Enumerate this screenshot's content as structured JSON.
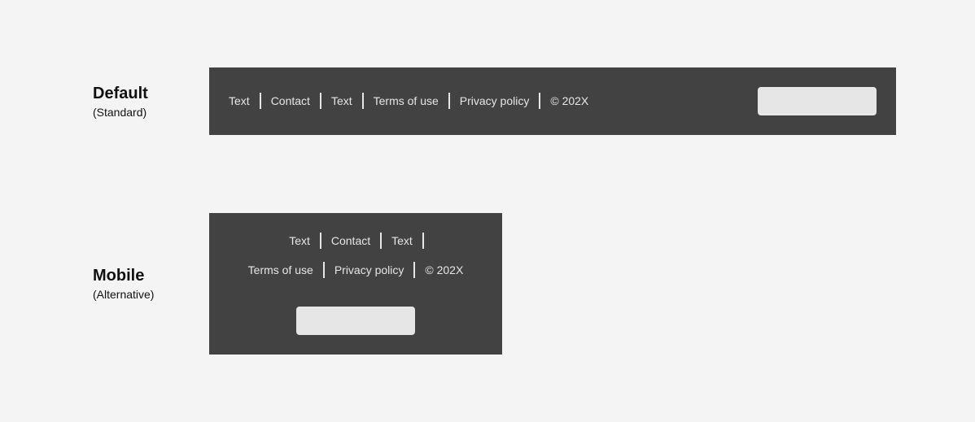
{
  "variants": {
    "default": {
      "title": "Default",
      "subtitle": "(Standard)"
    },
    "mobile": {
      "title": "Mobile",
      "subtitle": "(Alternative)"
    }
  },
  "footer_links": {
    "text_1": "Text",
    "contact": "Contact",
    "text_2": "Text",
    "terms": "Terms of use",
    "privacy": "Privacy policy",
    "copyright": "© 202X"
  },
  "colors": {
    "page_background": "#f4f4f4",
    "footer_background": "#424242",
    "footer_text": "#e6e6e6",
    "placeholder_button": "#e6e6e6"
  }
}
